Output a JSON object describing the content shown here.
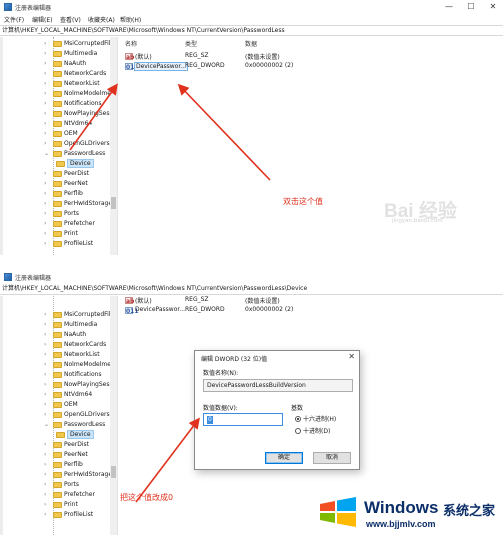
{
  "window": {
    "title": "注册表编辑器",
    "menu": [
      "文件(F)",
      "编辑(E)",
      "查看(V)",
      "收藏夹(A)",
      "帮助(H)"
    ],
    "minimize": "—",
    "maximize": "☐",
    "close": "✕"
  },
  "screen1": {
    "address": "计算机\\HKEY_LOCAL_MACHINE\\SOFTWARE\\Microsoft\\Windows NT\\CurrentVersion\\PasswordLess",
    "tree": [
      "MsiCorruptedFile",
      "Multimedia",
      "NaAuth",
      "NetworkCards",
      "NetworkList",
      "NolmeModelme",
      "Notifications",
      "NowPlayingSess",
      "NtVdm64",
      "OEM",
      "OpenGLDrivers",
      "PasswordLess",
      "Device",
      "PeerDist",
      "PeerNet",
      "Perflib",
      "PerHwIdStorage",
      "Ports",
      "Prefetcher",
      "Print",
      "ProfileList"
    ],
    "columns": {
      "name": "名称",
      "type": "类型",
      "data": "数据"
    },
    "values": [
      {
        "icon": "ab",
        "name": "(默认)",
        "type": "REG_SZ",
        "data": "(数值未设置)"
      },
      {
        "icon": "011",
        "name": "DevicePasswor...",
        "type": "REG_DWORD",
        "data": "0x00000002 (2)"
      }
    ],
    "annotation": "双击这个值"
  },
  "screen2": {
    "address": "计算机\\HKEY_LOCAL_MACHINE\\SOFTWARE\\Microsoft\\Windows NT\\CurrentVersion\\PasswordLess\\Device",
    "tree": [
      "MsiCorruptedFile",
      "Multimedia",
      "NaAuth",
      "NetworkCards",
      "NetworkList",
      "NolmeModelme",
      "Notifications",
      "NowPlayingSess",
      "NtVdm64",
      "OEM",
      "OpenGLDrivers",
      "PasswordLess",
      "Device",
      "PeerDist",
      "PeerNet",
      "Perflib",
      "PerHwIdStorage",
      "Ports",
      "Prefetcher",
      "Print",
      "ProfileList"
    ],
    "values": [
      {
        "icon": "ab",
        "name": "(默认)",
        "type": "REG_SZ",
        "data": "(数值未设置)"
      },
      {
        "icon": "011",
        "name": "DevicePasswor...",
        "type": "REG_DWORD",
        "data": "0x00000002 (2)"
      }
    ],
    "annotation": "把这个值改成0"
  },
  "dialog": {
    "title": "编辑 DWORD (32 位)值",
    "close": "✕",
    "name_label": "数值名称(N):",
    "name_value": "DevicePasswordLessBuildVersion",
    "data_label": "数值数据(V):",
    "data_value": "0",
    "base_label": "基数",
    "hex_label": "十六进制(H)",
    "dec_label": "十进制(D)",
    "ok": "确定",
    "cancel": "取消"
  },
  "watermark": {
    "text": "Bai 经验",
    "sub": "jingyan.baidu.com"
  },
  "branding": {
    "name": "Windows",
    "name2": "系统之家",
    "url": "www.bjjmlv.com"
  },
  "colors": {
    "annotation": "#e0321f",
    "selection": "#cce4f7",
    "brand": "#0c2f6a"
  }
}
